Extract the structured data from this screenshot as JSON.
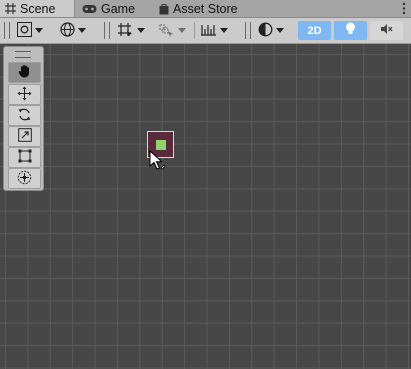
{
  "tabs": [
    {
      "label": "Scene",
      "icon": "grid-hash-icon",
      "active": true
    },
    {
      "label": "Game",
      "icon": "gamepad-icon",
      "active": false
    },
    {
      "label": "Asset Store",
      "icon": "shopping-bag-icon",
      "active": false
    }
  ],
  "toolbar": {
    "draw_mode_icon": "shaded-square-icon",
    "render_path_icon": "globe-icon",
    "grid_snap_icon": "grid-snap-icon",
    "increment_snap_icon": "increment-snap-icon",
    "ruler_icon": "ruler-icon",
    "view_options_icon": "shading-sphere-icon",
    "mode_2d_label": "2D",
    "mode_2d_active": true,
    "lighting_active": true,
    "audio_active": false
  },
  "tools": [
    {
      "name": "hand-tool",
      "icon": "hand-icon",
      "active": true
    },
    {
      "name": "move-tool",
      "icon": "move-arrows-icon",
      "active": false
    },
    {
      "name": "rotate-tool",
      "icon": "rotate-icon",
      "active": false
    },
    {
      "name": "scale-tool",
      "icon": "scale-icon",
      "active": false
    },
    {
      "name": "rect-tool",
      "icon": "rect-transform-icon",
      "active": false
    },
    {
      "name": "transform-tool",
      "icon": "transform-gizmo-icon",
      "active": false
    }
  ],
  "colors": {
    "scene_bg": "#474747",
    "grid_line": "#5b5b5b",
    "accent_blue": "#7fb7f2",
    "sprite_fill": "#5a2a3c",
    "sprite_inner": "#8fd46a"
  }
}
